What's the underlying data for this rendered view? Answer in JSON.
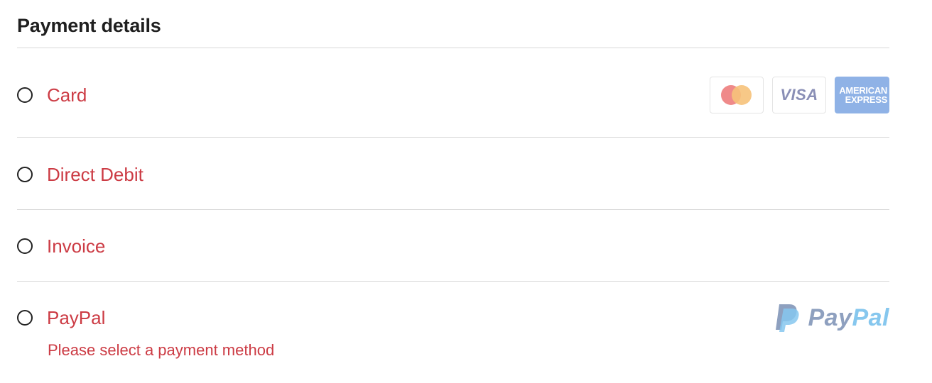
{
  "section": {
    "title": "Payment details"
  },
  "colors": {
    "label": "#cc3b44",
    "divider": "#d8d8d8",
    "title": "#1f1f1f"
  },
  "options": [
    {
      "label": "Card",
      "selected": false,
      "logos": {
        "mastercard_icon": "mastercard-logo",
        "visa_text": "VISA",
        "amex_line1": "AMERICAN",
        "amex_line2": "EXPRESS"
      }
    },
    {
      "label": "Direct Debit",
      "selected": false
    },
    {
      "label": "Invoice",
      "selected": false
    },
    {
      "label": "PayPal",
      "selected": false,
      "logos": {
        "paypal_icon": "paypal-p-logo",
        "paypal_pay": "Pay",
        "paypal_pal": "Pal"
      }
    }
  ],
  "validation": {
    "error": "Please select a payment method"
  }
}
